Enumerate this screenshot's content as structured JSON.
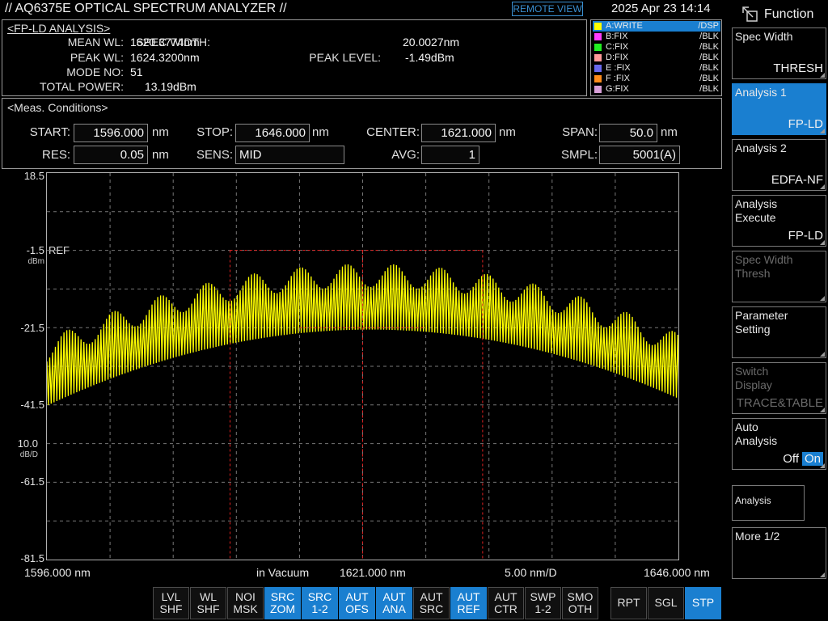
{
  "header": {
    "title": "// AQ6375E OPTICAL SPECTRUM ANALYZER //",
    "remote_label": "REMOTE VIEW",
    "datetime": "2025 Apr 23 14:14"
  },
  "analysis": {
    "title": "<FP-LD ANALYSIS>",
    "mean_wl_label": "MEAN WL:",
    "mean_wl": "1620.3774nm",
    "peak_wl_label": "PEAK WL:",
    "peak_wl": "1624.3200nm",
    "mode_no_label": "MODE NO:",
    "mode_no": "51",
    "total_power_label": "TOTAL POWER:",
    "total_power": "13.19dBm",
    "spec_width_label": "SPEC WIDTH:",
    "spec_width": "20.0027nm",
    "peak_level_label": "PEAK LEVEL:",
    "peak_level": "-1.49dBm"
  },
  "traces": [
    {
      "name": "A:WRITE",
      "mode": "/DSP",
      "color": "#ffff00",
      "active": true
    },
    {
      "name": "B:FIX",
      "mode": "/BLK",
      "color": "#ff3cff",
      "active": false
    },
    {
      "name": "C:FIX",
      "mode": "/BLK",
      "color": "#22ee22",
      "active": false
    },
    {
      "name": "D:FIX",
      "mode": "/BLK",
      "color": "#ff9a9a",
      "active": false
    },
    {
      "name": "E :FIX",
      "mode": "/BLK",
      "color": "#6a6aee",
      "active": false
    },
    {
      "name": "F :FIX",
      "mode": "/BLK",
      "color": "#ff8c1a",
      "active": false
    },
    {
      "name": "G:FIX",
      "mode": "/BLK",
      "color": "#d8a0d8",
      "active": false
    }
  ],
  "meas": {
    "title": "<Meas. Conditions>",
    "start_label": "START:",
    "start": "1596.000",
    "start_unit": "nm",
    "stop_label": "STOP:",
    "stop": "1646.000",
    "stop_unit": "nm",
    "center_label": "CENTER:",
    "center": "1621.000",
    "center_unit": "nm",
    "span_label": "SPAN:",
    "span": "50.0",
    "span_unit": "nm",
    "res_label": "RES:",
    "res": "0.05",
    "res_unit": "nm",
    "sens_label": "SENS:",
    "sens": "MID",
    "avg_label": "AVG:",
    "avg": "1",
    "smpl_label": "SMPL:",
    "smpl": "5001(A)"
  },
  "graph": {
    "y_top": "18.5",
    "y_ref": "-1.5",
    "ref_label": "REF",
    "ref_unit": "dBm",
    "y_mid1": "-21.5",
    "y_mid2": "-41.5",
    "scale": "10.0",
    "scale_unit": "dB/D",
    "y_mid3": "-61.5",
    "y_bottom": "-81.5",
    "x_start": "1596.000",
    "x_start_unit": "nm",
    "medium": "in Vacuum",
    "x_center": "1621.000",
    "x_center_unit": "nm",
    "x_div": "5.00",
    "x_div_unit": "nm/D",
    "x_stop": "1646.000",
    "x_stop_unit": "nm",
    "trace_color": "#ffff00"
  },
  "spectrum": {
    "ylim": [
      -81.5,
      18.5
    ],
    "xlim": [
      1596.0,
      1646.0
    ],
    "mode_spacing_nm": 0.45,
    "peak_wl": 1624.32,
    "peak_level": -1.49,
    "spec_width_markers_nm": [
      1610.5,
      1630.5
    ],
    "threshold_level": -21.5
  },
  "func": {
    "title": "Function",
    "buttons": [
      {
        "name": "Spec Width",
        "value": "THRESH",
        "selected": false,
        "disabled": false
      },
      {
        "name": "Analysis 1",
        "value": "FP-LD",
        "selected": true,
        "disabled": false
      },
      {
        "name": "Analysis 2",
        "value": "EDFA-NF",
        "selected": false,
        "disabled": false
      },
      {
        "name": "Analysis\nExecute",
        "value": "FP-LD",
        "selected": false,
        "disabled": false
      },
      {
        "name": "Spec Width\nThresh",
        "value": "",
        "selected": false,
        "disabled": true
      },
      {
        "name": "Parameter\nSetting",
        "value": "",
        "selected": false,
        "disabled": false
      },
      {
        "name": "Switch\nDisplay",
        "value": "TRACE&TABLE",
        "selected": false,
        "disabled": true
      },
      {
        "name": "Auto\nAnalysis",
        "value_off": "Off",
        "value_on": "On",
        "selected": false,
        "disabled": false
      },
      {
        "name": "Analysis",
        "value": "",
        "selected": false,
        "disabled": false
      },
      {
        "name": "More 1/2",
        "value": "",
        "selected": false,
        "disabled": false
      }
    ]
  },
  "softkeys": [
    {
      "label": "LVL\nSHF",
      "on": false
    },
    {
      "label": "WL\nSHF",
      "on": false
    },
    {
      "label": "NOI\nMSK",
      "on": false
    },
    {
      "label": "SRC\nZOM",
      "on": true
    },
    {
      "label": "SRC\n1-2",
      "on": true
    },
    {
      "label": "AUT\nOFS",
      "on": true
    },
    {
      "label": "AUT\nANA",
      "on": true
    },
    {
      "label": "AUT\nSRC",
      "on": false
    },
    {
      "label": "AUT\nREF",
      "on": true
    },
    {
      "label": "AUT\nCTR",
      "on": false
    },
    {
      "label": "SWP\n1-2",
      "on": false
    },
    {
      "label": "SMO\nOTH",
      "on": false
    }
  ],
  "sweep_keys": [
    {
      "label": "RPT",
      "on": false
    },
    {
      "label": "SGL",
      "on": false
    },
    {
      "label": "STP",
      "on": true
    }
  ]
}
